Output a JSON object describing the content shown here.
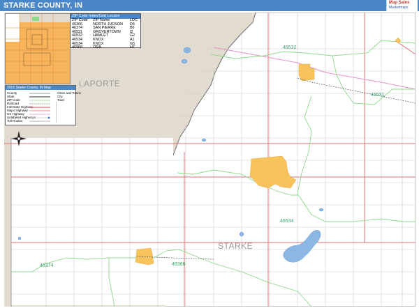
{
  "header": {
    "title": "STARKE COUNTY, IN",
    "logo_line1": "Map Sales",
    "logo_line2": "Marketmaps"
  },
  "zip_table": {
    "title": "ZIP Code Index/Grid Locator",
    "columns": [
      "ZIP Code",
      "ZIP Name",
      "LOC"
    ],
    "rows": [
      [
        "46366",
        "NORTH JUDSON",
        "D6"
      ],
      [
        "46374",
        "SAN PIERRE",
        "B6"
      ],
      [
        "46531",
        "GROVERTOWN",
        "I2"
      ],
      [
        "46532",
        "HAMLET",
        "G2"
      ],
      [
        "46534",
        "KNOX",
        "A1"
      ],
      [
        "46534",
        "KNOX",
        "G5"
      ],
      [
        "46968",
        "ORA",
        "H7"
      ]
    ]
  },
  "legend": {
    "title": "2016 Starke County, IN Map",
    "rows": [
      {
        "label": "County",
        "extra": "Cities and Towns"
      },
      {
        "label": "State",
        "extra": "City"
      },
      {
        "label": "ZIP Code",
        "extra": "Town"
      },
      {
        "label": "Railroad",
        "extra": ""
      },
      {
        "label": "Interstate Highway",
        "extra": ""
      },
      {
        "label": "Major Highway",
        "extra": ""
      },
      {
        "label": "US Highway",
        "extra": ""
      },
      {
        "label": "Unlabeled Highways",
        "extra": ""
      },
      {
        "label": "Toll Routes",
        "extra": ""
      }
    ]
  },
  "map_labels": {
    "neighbor_county": "LAPORTE",
    "county": "STARKE",
    "zips": [
      "46532",
      "46531",
      "46534",
      "46366",
      "46374"
    ]
  },
  "colors": {
    "header": "#4a87c8",
    "town_fill": "#f7c35a",
    "neighbor_land": "#e2dcd0",
    "zip_boundary": "#8fd98a",
    "road_red": "#e07070",
    "water": "#8bb7e3"
  },
  "icons": [
    "compass-rose-icon"
  ]
}
